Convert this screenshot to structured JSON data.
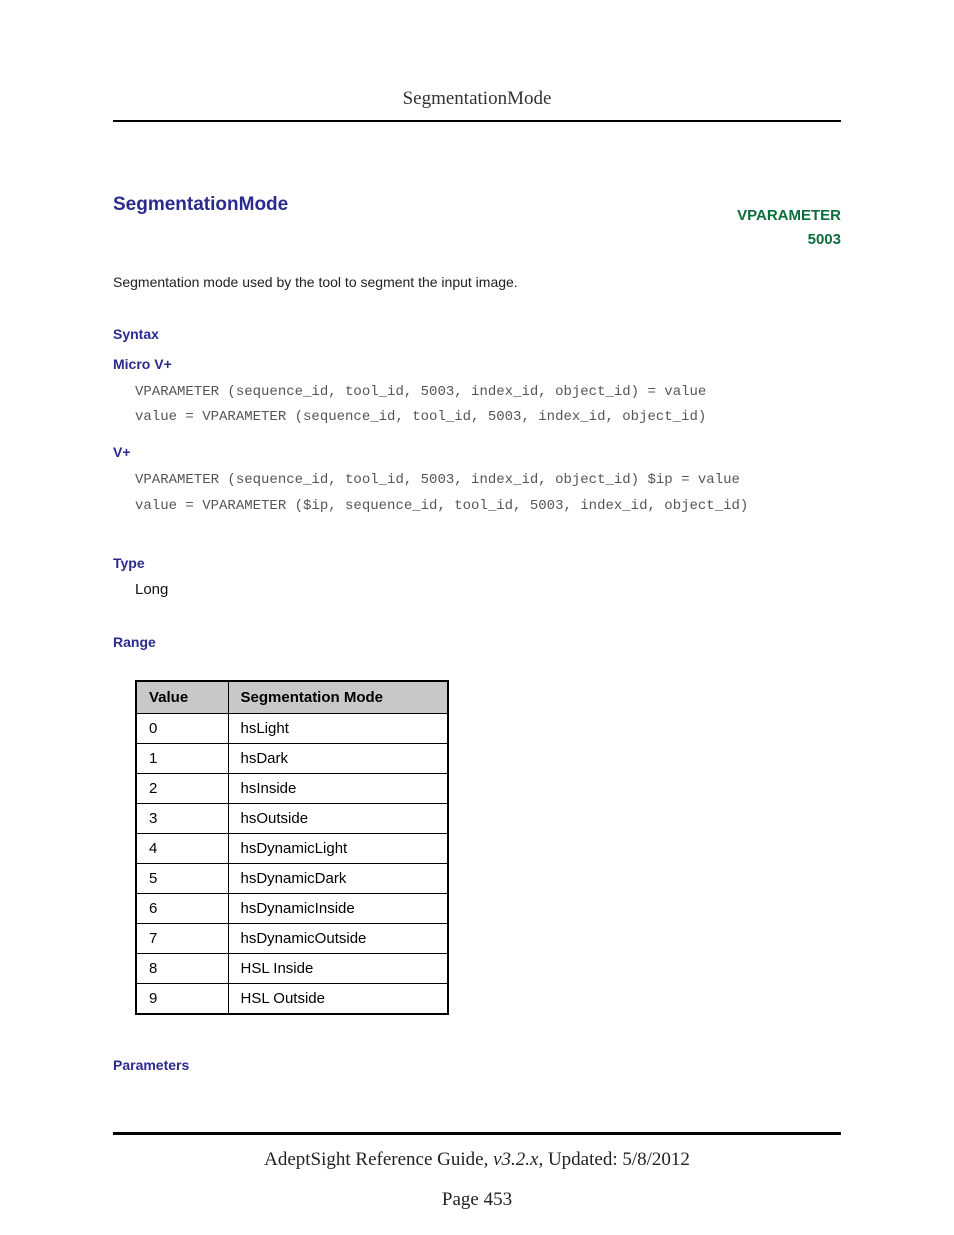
{
  "header": {
    "title": "SegmentationMode"
  },
  "title": "SegmentationMode",
  "param_tag": {
    "line1": "VPARAMETER",
    "line2": "5003"
  },
  "description": "Segmentation mode used by the tool to segment the input image.",
  "syntax": {
    "heading": "Syntax",
    "micro_v_plus": {
      "label": "Micro V+",
      "code": "VPARAMETER (sequence_id, tool_id, 5003, index_id, object_id) = value\nvalue = VPARAMETER (sequence_id, tool_id, 5003, index_id, object_id)"
    },
    "v_plus": {
      "label": "V+",
      "code": "VPARAMETER (sequence_id, tool_id, 5003, index_id, object_id) $ip = value\nvalue = VPARAMETER ($ip, sequence_id, tool_id, 5003, index_id, object_id)"
    }
  },
  "type_section": {
    "heading": "Type",
    "value": "Long"
  },
  "range_section": {
    "heading": "Range",
    "headers": [
      "Value",
      "Segmentation Mode"
    ],
    "rows": [
      [
        "0",
        "hsLight"
      ],
      [
        "1",
        "hsDark"
      ],
      [
        "2",
        "hsInside"
      ],
      [
        "3",
        "hsOutside"
      ],
      [
        "4",
        "hsDynamicLight"
      ],
      [
        "5",
        "hsDynamicDark"
      ],
      [
        "6",
        "hsDynamicInside"
      ],
      [
        "7",
        "hsDynamicOutside"
      ],
      [
        "8",
        "HSL Inside"
      ],
      [
        "9",
        "HSL Outside"
      ]
    ]
  },
  "parameters_heading": "Parameters",
  "footer": {
    "guide": "AdeptSight Reference Guide",
    "version": ", v3.2.x",
    "updated": ", Updated: 5/8/2012",
    "page": "Page 453"
  }
}
